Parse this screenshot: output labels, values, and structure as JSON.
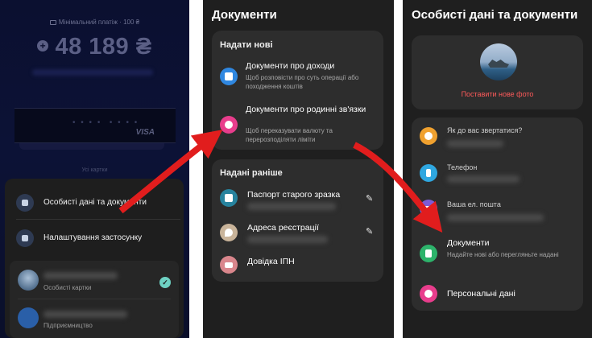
{
  "screen1": {
    "min_payment": "Мінімальний платіж · 100 ₴",
    "balance": "48 189 ₴",
    "card_brand": "VISA",
    "all_cards": "Усі картки",
    "menu": [
      {
        "label": "Особисті дані та документи",
        "icon": "id-card-icon"
      },
      {
        "label": "Налаштування застосунку",
        "icon": "gear-icon"
      }
    ],
    "accounts": [
      {
        "sub": "Особисті картки"
      },
      {
        "sub": "Підприємництво"
      }
    ]
  },
  "screen2": {
    "title": "Документи",
    "new_section": {
      "heading": "Надати нові",
      "items": [
        {
          "title": "Документи про доходи",
          "subtitle": "Щоб розповісти про суть операції або походження коштів",
          "icon": "bank-icon",
          "color": "#2f87e0"
        },
        {
          "title": "Документи про родинні зв'язки",
          "subtitle": "Щоб переказувати валюту та перерозподіляти ліміти",
          "icon": "rings-icon",
          "color": "#e83d8c"
        }
      ]
    },
    "old_section": {
      "heading": "Надані раніше",
      "items": [
        {
          "title": "Паспорт старого зразка",
          "icon": "passport-icon",
          "color": "#27839e",
          "edit": true
        },
        {
          "title": "Адреса реєстрації",
          "icon": "location-icon",
          "color": "#c9b49a",
          "edit": true
        },
        {
          "title": "Довідка ІПН",
          "icon": "id-document-icon",
          "color": "#d9868c",
          "edit": false
        }
      ]
    }
  },
  "screen3": {
    "title": "Особисті дані та документи",
    "set_photo": "Поставити нове фото",
    "fields": [
      {
        "label": "Як до вас звертатися?",
        "icon": "chat-bubble-icon",
        "color": "#f0a12f"
      },
      {
        "label": "Телефон",
        "icon": "phone-icon",
        "color": "#2fa7e0"
      },
      {
        "label": "Ваша ел. пошта",
        "icon": "mail-icon",
        "color": "#7d5bd6"
      }
    ],
    "links": [
      {
        "title": "Документи",
        "subtitle": "Надайте нові або перегляньте надані",
        "icon": "document-icon",
        "color": "#2db36b"
      },
      {
        "title": "Персональні дані",
        "icon": "person-icon",
        "color": "#e83d8c"
      }
    ]
  },
  "colors": {
    "arrow": "#e11d1d",
    "app_bg": "#1f1f1f",
    "card_bg": "#2d2d2d"
  }
}
